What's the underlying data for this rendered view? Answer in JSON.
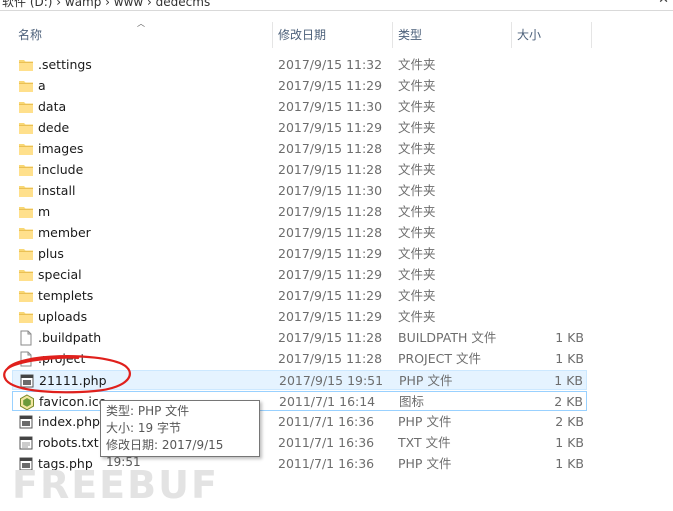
{
  "address": {
    "path": "软件 (D:)  ›  wamp  ›  www  ›  dedecms",
    "close_glyph": "✕"
  },
  "columns": {
    "name": "名称",
    "date": "修改日期",
    "type": "类型",
    "size": "大小"
  },
  "files": [
    {
      "name": ".settings",
      "date": "2017/9/15 11:32",
      "type": "文件夹",
      "size": "",
      "icon": "folder-icon"
    },
    {
      "name": "a",
      "date": "2017/9/15 11:29",
      "type": "文件夹",
      "size": "",
      "icon": "folder-icon"
    },
    {
      "name": "data",
      "date": "2017/9/15 11:30",
      "type": "文件夹",
      "size": "",
      "icon": "folder-icon"
    },
    {
      "name": "dede",
      "date": "2017/9/15 11:29",
      "type": "文件夹",
      "size": "",
      "icon": "folder-icon"
    },
    {
      "name": "images",
      "date": "2017/9/15 11:28",
      "type": "文件夹",
      "size": "",
      "icon": "folder-icon"
    },
    {
      "name": "include",
      "date": "2017/9/15 11:28",
      "type": "文件夹",
      "size": "",
      "icon": "folder-icon"
    },
    {
      "name": "install",
      "date": "2017/9/15 11:30",
      "type": "文件夹",
      "size": "",
      "icon": "folder-icon"
    },
    {
      "name": "m",
      "date": "2017/9/15 11:28",
      "type": "文件夹",
      "size": "",
      "icon": "folder-icon"
    },
    {
      "name": "member",
      "date": "2017/9/15 11:28",
      "type": "文件夹",
      "size": "",
      "icon": "folder-icon"
    },
    {
      "name": "plus",
      "date": "2017/9/15 11:29",
      "type": "文件夹",
      "size": "",
      "icon": "folder-icon"
    },
    {
      "name": "special",
      "date": "2017/9/15 11:29",
      "type": "文件夹",
      "size": "",
      "icon": "folder-icon"
    },
    {
      "name": "templets",
      "date": "2017/9/15 11:29",
      "type": "文件夹",
      "size": "",
      "icon": "folder-icon"
    },
    {
      "name": "uploads",
      "date": "2017/9/15 11:29",
      "type": "文件夹",
      "size": "",
      "icon": "folder-icon"
    },
    {
      "name": ".buildpath",
      "date": "2017/9/15 11:28",
      "type": "BUILDPATH 文件",
      "size": "1 KB",
      "icon": "file-icon"
    },
    {
      "name": ".project",
      "date": "2017/9/15 11:28",
      "type": "PROJECT 文件",
      "size": "1 KB",
      "icon": "file-icon"
    },
    {
      "name": "21111.php",
      "date": "2017/9/15 19:51",
      "type": "PHP 文件",
      "size": "1 KB",
      "icon": "php-file-icon",
      "state": "selected"
    },
    {
      "name": "favicon.ico",
      "date": "2011/7/1 16:14",
      "type": "图标",
      "size": "2 KB",
      "icon": "favicon-icon",
      "state": "hover"
    },
    {
      "name": "index.php",
      "date": "2011/7/1 16:36",
      "type": "PHP 文件",
      "size": "2 KB",
      "icon": "php-file-icon"
    },
    {
      "name": "robots.txt",
      "date": "2011/7/1 16:36",
      "type": "TXT 文件",
      "size": "1 KB",
      "icon": "text-file-icon"
    },
    {
      "name": "tags.php",
      "date": "2011/7/1 16:36",
      "type": "PHP 文件",
      "size": "1 KB",
      "icon": "php-file-icon"
    }
  ],
  "tooltip": {
    "type_line": "类型: PHP 文件",
    "size_line": "大小: 19 字节",
    "date_line": "修改日期: 2017/9/15 19:51"
  },
  "watermark": "FREEBUF",
  "colors": {
    "selected_bg": "#e5f3ff",
    "hover_border": "#99d1ff",
    "folder": "#f8d775",
    "annotation": "#e0201c"
  }
}
